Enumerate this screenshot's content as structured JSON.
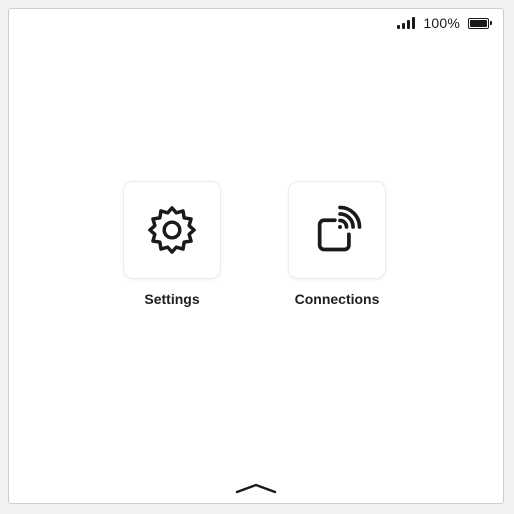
{
  "status_bar": {
    "signal_bars": 4,
    "battery_text": "100%",
    "battery_level": 1.0
  },
  "apps": [
    {
      "label": "Settings",
      "icon": "gear-icon"
    },
    {
      "label": "Connections",
      "icon": "cast-signal-icon"
    }
  ],
  "home_handle": {
    "icon": "chevron-up-icon"
  },
  "colors": {
    "foreground": "#1a1a1a",
    "background": "#ffffff",
    "tile_border": "#ececec"
  }
}
